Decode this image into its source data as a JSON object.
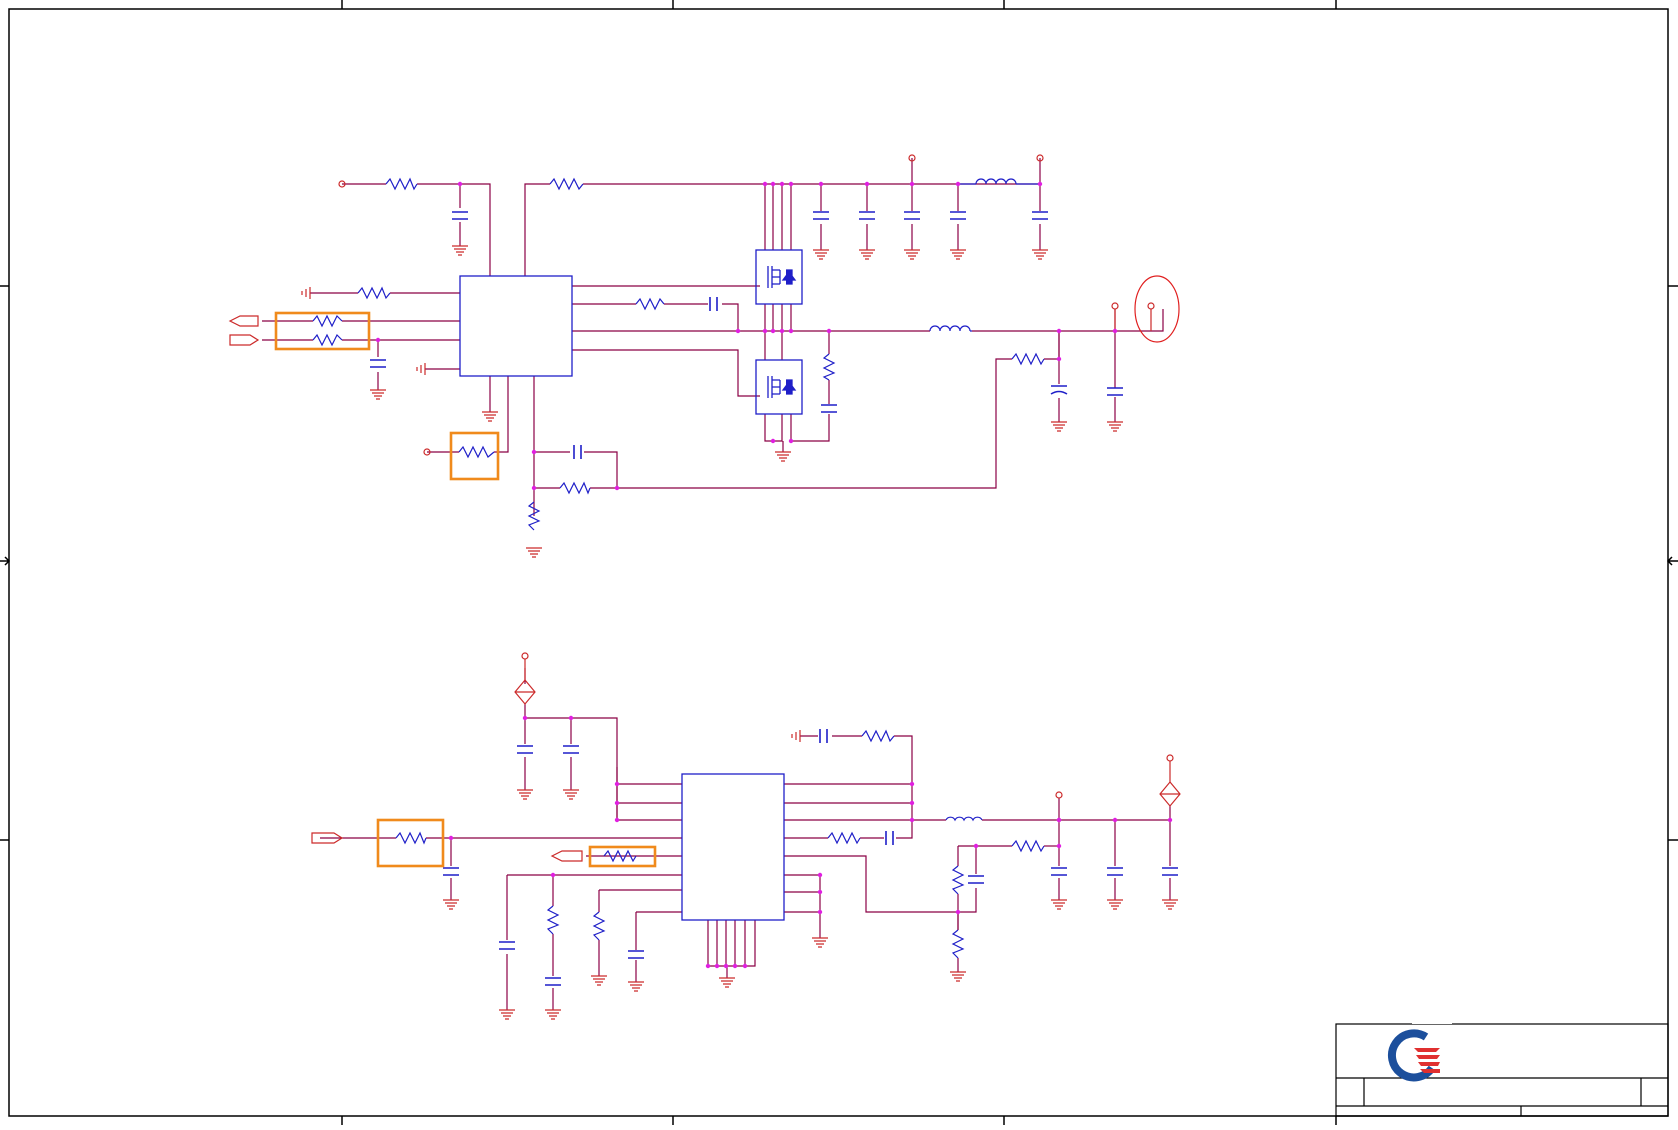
{
  "sheet": {
    "title": "",
    "border_color": "#000000",
    "wire_color": "#8b0045",
    "net_color": "#cc2a2a",
    "component_color": "#1f1fc8",
    "junction_color": "#e020e0",
    "highlight_color": "#f08a1c",
    "note_circle_color": "#e02020"
  },
  "logo": {
    "name": "quanta-logo-icon",
    "ring_color": "#1c4f9c",
    "stripe_color": "#e03030"
  },
  "title_block": {
    "company": "",
    "title": "",
    "size": "",
    "doc_number": "",
    "rev": "",
    "date": "",
    "sheet": ""
  }
}
